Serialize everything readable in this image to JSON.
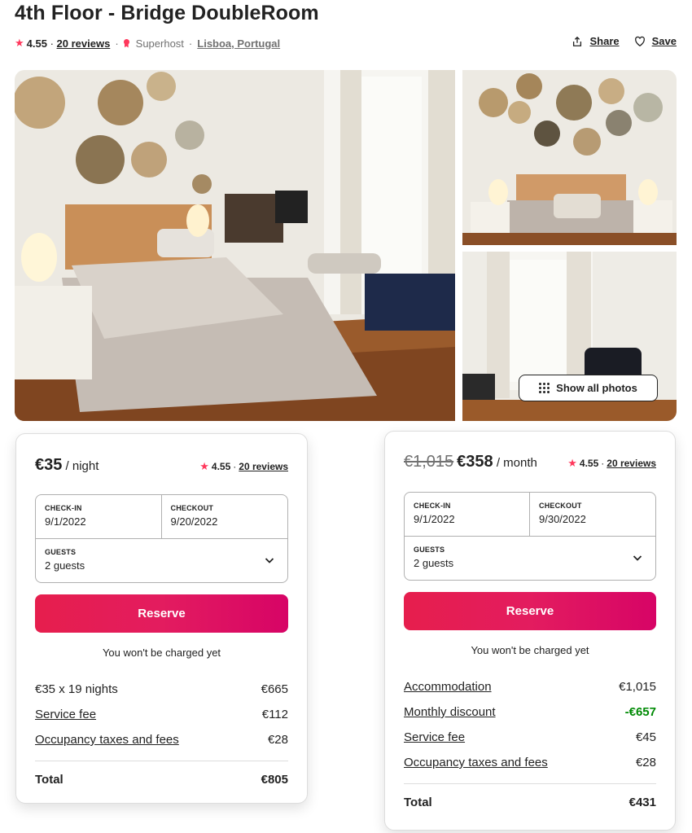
{
  "listing": {
    "title": "4th Floor - Bridge DoubleRoom",
    "rating": "4.55",
    "reviews": "20 reviews",
    "host_badge": "Superhost",
    "location": "Lisboa, Portugal",
    "share_label": "Share",
    "save_label": "Save",
    "show_all_label": "Show all photos"
  },
  "nightly": {
    "price": "€35",
    "per": " / night",
    "rating": "4.55",
    "reviews": "20 reviews",
    "checkin_label": "CHECK-IN",
    "checkin": "9/1/2022",
    "checkout_label": "CHECKOUT",
    "checkout": "9/20/2022",
    "guests_label": "GUESTS",
    "guests": "2 guests",
    "reserve_label": "Reserve",
    "note": "You won't be charged yet",
    "lines": [
      {
        "label": "€35 x 19 nights",
        "amount": "€665"
      },
      {
        "label": "Service fee",
        "amount": "€112"
      },
      {
        "label": "Occupancy taxes and fees",
        "amount": "€28"
      }
    ],
    "total_label": "Total",
    "total": "€805"
  },
  "monthly": {
    "old_price": "€1,015",
    "price": "€358",
    "per": " / month",
    "rating": "4.55",
    "reviews": "20 reviews",
    "checkin_label": "CHECK-IN",
    "checkin": "9/1/2022",
    "checkout_label": "CHECKOUT",
    "checkout": "9/30/2022",
    "guests_label": "GUESTS",
    "guests": "2 guests",
    "reserve_label": "Reserve",
    "note": "You won't be charged yet",
    "lines": [
      {
        "label": "Accommodation",
        "amount": "€1,015"
      },
      {
        "label": "Monthly discount",
        "amount": "-€657"
      },
      {
        "label": "Service fee",
        "amount": "€45"
      },
      {
        "label": "Occupancy taxes and fees",
        "amount": "€28"
      }
    ],
    "total_label": "Total",
    "total": "€431"
  },
  "colors": {
    "brand": "#ff385c",
    "discount": "#008a05",
    "text": "#222222",
    "muted": "#717171"
  },
  "icons": [
    "star-icon",
    "superhost-icon",
    "share-icon",
    "heart-icon",
    "grid-dots-icon",
    "chevron-down-icon"
  ]
}
